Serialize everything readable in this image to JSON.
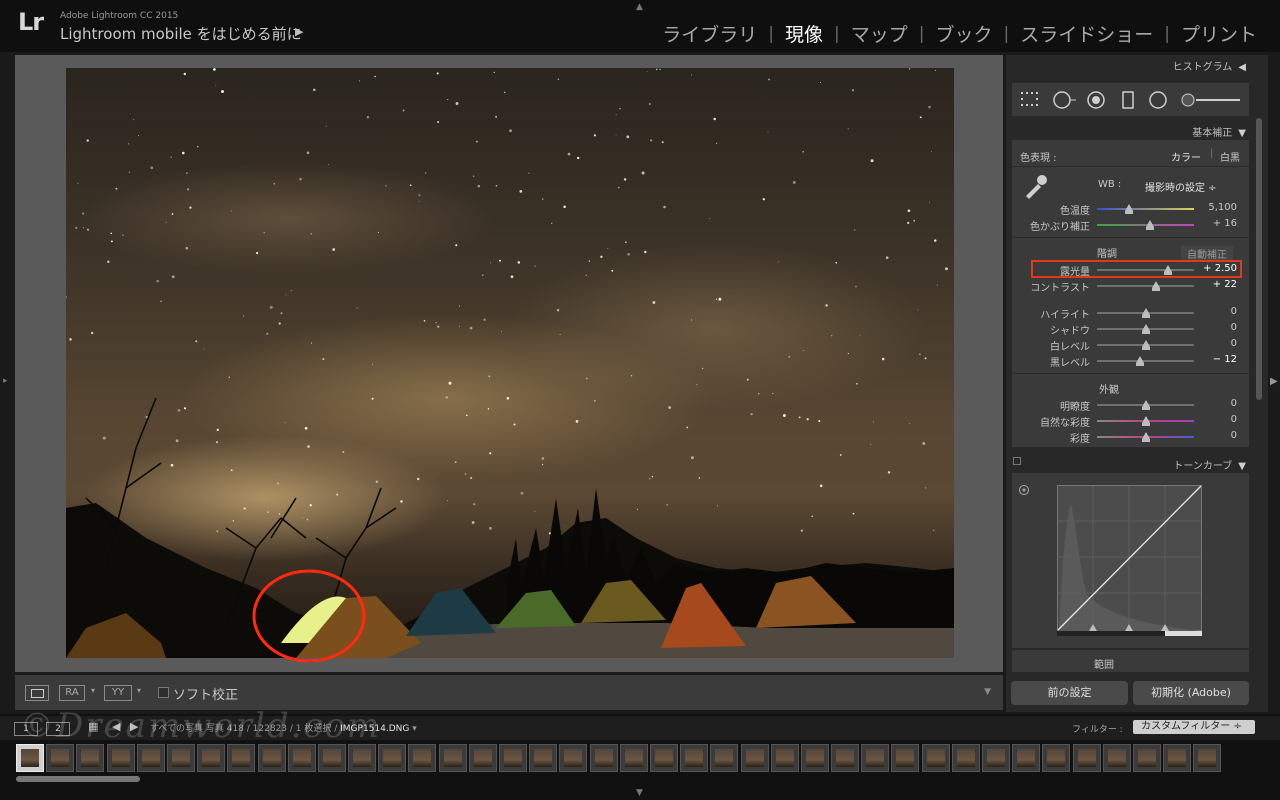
{
  "app": {
    "logo": "Lr",
    "title": "Adobe Lightroom CC 2015",
    "promo": "Lightroom mobile をはじめる前に",
    "promo_arrow": "▶"
  },
  "modules": [
    "ライブラリ",
    "現像",
    "マップ",
    "ブック",
    "スライドショー",
    "プリント"
  ],
  "active_module": "現像",
  "toolbar": {
    "ra_label": "RA",
    "yy_label": "YY",
    "soft_proof_label": "ソフト校正"
  },
  "right_panel": {
    "histogram_label": "ヒストグラム",
    "basic_label": "基本補正",
    "color_treatment_label": "色表現 :",
    "color_label": "カラー",
    "bw_label": "白黒",
    "wb_label": "WB :",
    "wb_value": "撮影時の設定 ÷",
    "tone_section_label": "階調",
    "auto_label": "自動補正",
    "presence_label": "外観",
    "tone_curve_label": "トーンカーブ",
    "range_label": "範囲",
    "sliders": {
      "temp": {
        "label": "色温度",
        "value": "5,100",
        "level": 0.33
      },
      "tint": {
        "label": "色かぶり補正",
        "value": "+ 16",
        "level": 0.55
      },
      "exposure": {
        "label": "露光量",
        "value": "+ 2.50",
        "level": 0.73
      },
      "contrast": {
        "label": "コントラスト",
        "value": "+ 22",
        "level": 0.61
      },
      "highlights": {
        "label": "ハイライト",
        "value": "0",
        "level": 0.5
      },
      "shadows": {
        "label": "シャドウ",
        "value": "0",
        "level": 0.5
      },
      "whites": {
        "label": "白レベル",
        "value": "0",
        "level": 0.5
      },
      "blacks": {
        "label": "黒レベル",
        "value": "− 12",
        "level": 0.44
      },
      "clarity": {
        "label": "明瞭度",
        "value": "0",
        "level": 0.5
      },
      "vibrance": {
        "label": "自然な彩度",
        "value": "0",
        "level": 0.5
      },
      "saturation": {
        "label": "彩度",
        "value": "0",
        "level": 0.5
      }
    },
    "previous_button": "前の設定",
    "reset_button": "初期化 (Adobe)"
  },
  "filmstrip": {
    "view1": "1",
    "view2": "2",
    "path_prefix": "すべての写真 写真 418 / 122823 / 1 枚選択 /",
    "selected_file": "IMGP1514.DNG",
    "path_suffix": "▾",
    "filter_label": "フィルター :",
    "filter_value": "カスタムフィルター ÷"
  },
  "watermark": "©Dreamworld.com",
  "colors": {
    "highlight_box": "#e03a1e",
    "annotation_circle": "#ff2a10"
  }
}
